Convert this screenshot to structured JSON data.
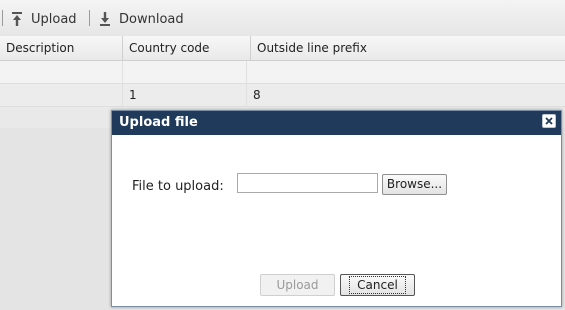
{
  "toolbar": {
    "upload_label": "Upload",
    "download_label": "Download",
    "upload_icon": "upload-icon",
    "download_icon": "download-icon"
  },
  "grid": {
    "columns": [
      "Description",
      "Country code",
      "Outside line prefix"
    ],
    "rows": [
      [
        "",
        "",
        ""
      ],
      [
        "",
        "1",
        "8"
      ]
    ]
  },
  "dialog": {
    "title": "Upload file",
    "close_icon": "close-icon",
    "file_label": "File to upload:",
    "file_value": "",
    "browse_label": "Browse...",
    "upload_label": "Upload",
    "cancel_label": "Cancel"
  },
  "colors": {
    "title_bar": "#1f3a5a",
    "toolbar_bg": "#e6e6e6"
  }
}
